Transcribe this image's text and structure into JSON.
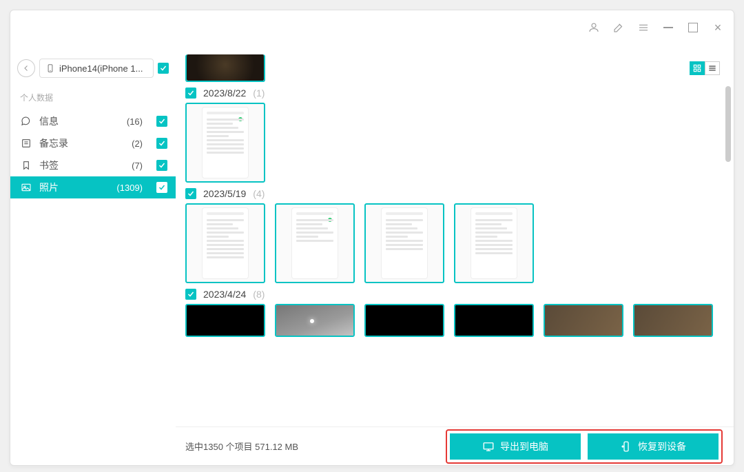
{
  "device": {
    "name": "iPhone14(iPhone 1..."
  },
  "section_label": "个人数据",
  "nav": [
    {
      "key": "messages",
      "label": "信息",
      "count": "(16)"
    },
    {
      "key": "notes",
      "label": "备忘录",
      "count": "(2)"
    },
    {
      "key": "bookmarks",
      "label": "书签",
      "count": "(7)"
    },
    {
      "key": "photos",
      "label": "照片",
      "count": "(1309)"
    }
  ],
  "groups": [
    {
      "date": "2023/8/22",
      "count": "(1)"
    },
    {
      "date": "2023/5/19",
      "count": "(4)"
    },
    {
      "date": "2023/4/24",
      "count": "(8)"
    }
  ],
  "footer": {
    "status": "选中1350 个项目 571.12 MB",
    "export": "导出到电脑",
    "restore": "恢复到设备"
  }
}
